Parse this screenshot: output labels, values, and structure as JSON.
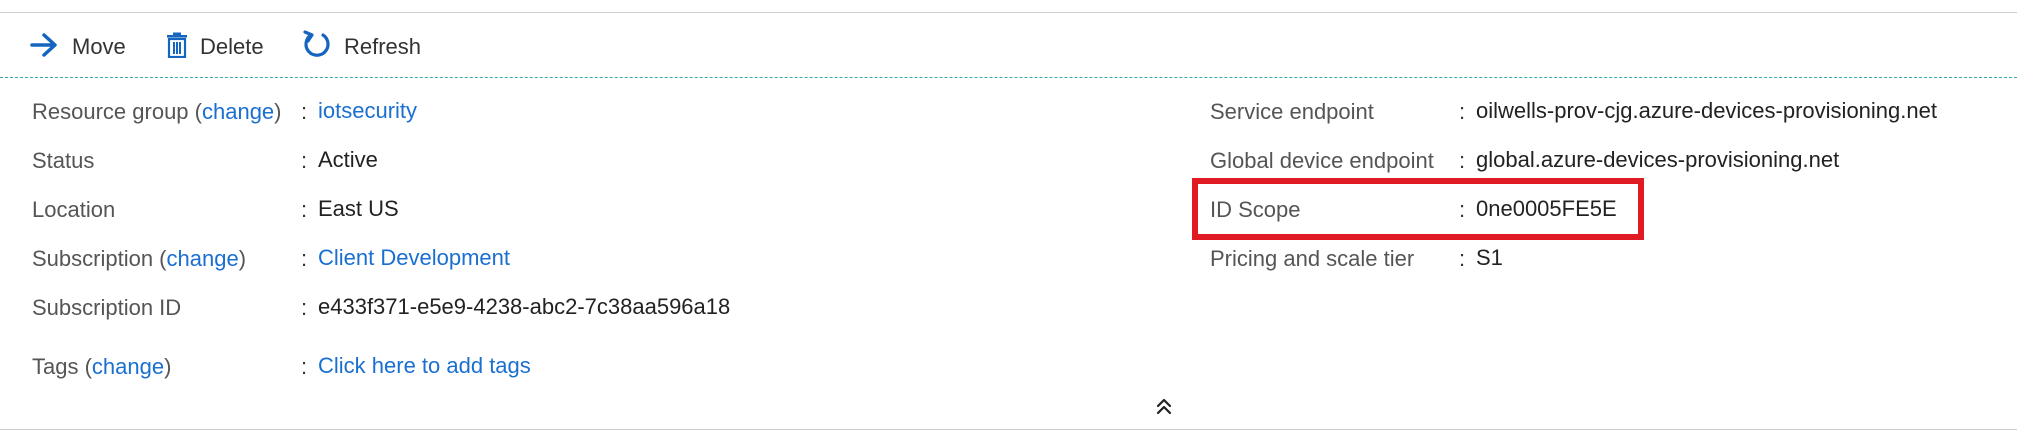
{
  "toolbar": {
    "move_label": "Move",
    "delete_label": "Delete",
    "refresh_label": "Refresh"
  },
  "left": {
    "resource_group": {
      "label_pre": "Resource group (",
      "change": "change",
      "label_post": ")",
      "value": "iotsecurity"
    },
    "status": {
      "label": "Status",
      "value": "Active"
    },
    "location": {
      "label": "Location",
      "value": "East US"
    },
    "subscription": {
      "label_pre": "Subscription (",
      "change": "change",
      "label_post": ")",
      "value": "Client Development"
    },
    "subscription_id": {
      "label": "Subscription ID",
      "value": "e433f371-e5e9-4238-abc2-7c38aa596a18"
    },
    "tags": {
      "label_pre": "Tags (",
      "change": "change",
      "label_post": ")",
      "value": "Click here to add tags"
    }
  },
  "right": {
    "service_endpoint": {
      "label": "Service endpoint",
      "value": "oilwells-prov-cjg.azure-devices-provisioning.net"
    },
    "global_endpoint": {
      "label": "Global device endpoint",
      "value": "global.azure-devices-provisioning.net"
    },
    "id_scope": {
      "label": "ID Scope",
      "value": "0ne0005FE5E"
    },
    "pricing": {
      "label": "Pricing and scale tier",
      "value": "S1"
    }
  },
  "separator": ":",
  "colors": {
    "link": "#1a6fd1",
    "highlight": "#e01b24",
    "icon_blue": "#1565c0"
  }
}
